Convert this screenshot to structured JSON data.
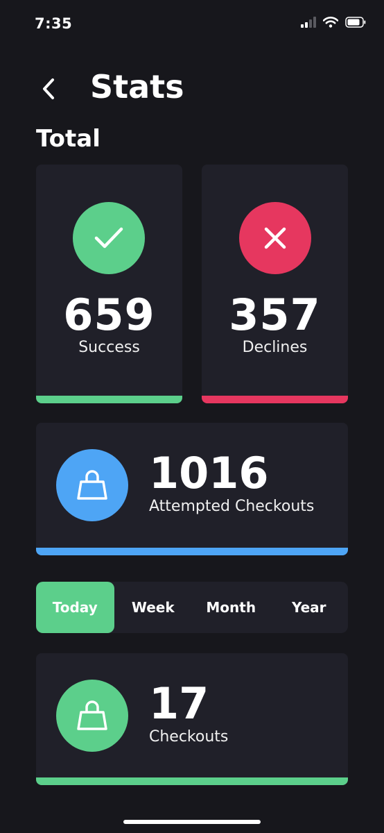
{
  "status_bar": {
    "time": "7:35"
  },
  "header": {
    "title": "Stats",
    "back_icon": "chevron-left-icon"
  },
  "section": {
    "title": "Total"
  },
  "colors": {
    "success": "#5ccf8b",
    "decline": "#e6375f",
    "attempted": "#4ea5f5",
    "card": "#202029",
    "background": "#17171c"
  },
  "total": {
    "success": {
      "value": "659",
      "label": "Success",
      "icon": "check-icon"
    },
    "declines": {
      "value": "357",
      "label": "Declines",
      "icon": "x-icon"
    },
    "attempted": {
      "value": "1016",
      "label": "Attempted Checkouts",
      "icon": "bag-icon"
    }
  },
  "period_tabs": {
    "items": [
      "Today",
      "Week",
      "Month",
      "Year"
    ],
    "selected": "Today"
  },
  "period_stats": {
    "value": "17",
    "label": "Checkouts",
    "icon": "bag-icon"
  }
}
